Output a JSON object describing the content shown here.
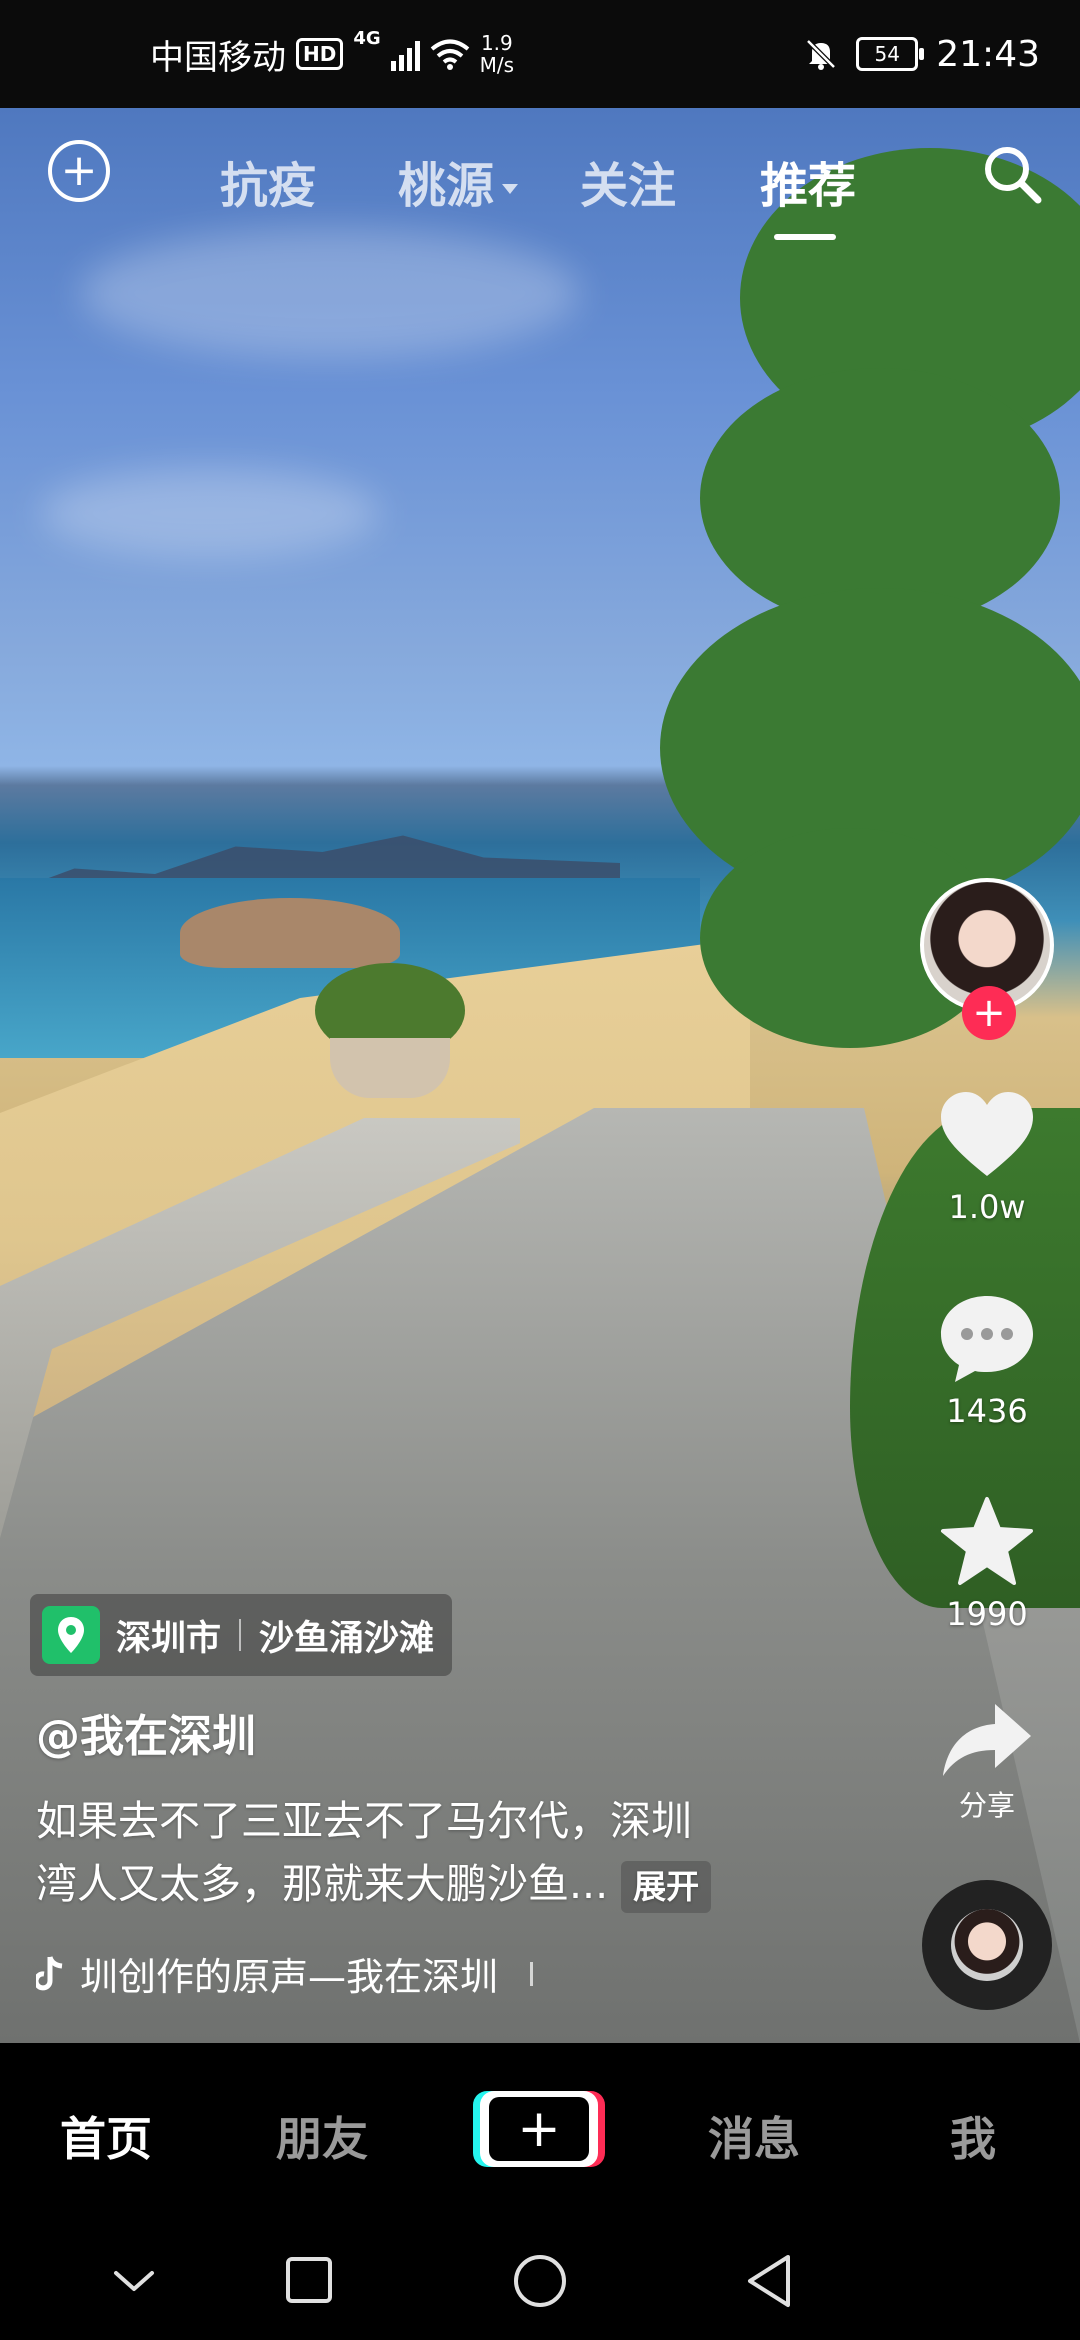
{
  "status_bar": {
    "carrier": "中国移动",
    "hd": "HD",
    "network": "4G",
    "speed_value": "1.9",
    "speed_unit": "M/s",
    "battery": "54",
    "time": "21:43"
  },
  "top_nav": {
    "tabs": [
      {
        "label": "抗疫"
      },
      {
        "label": "桃源"
      },
      {
        "label": "关注"
      },
      {
        "label": "推荐"
      }
    ],
    "active_tab": "推荐"
  },
  "side_actions": {
    "likes": "1.0w",
    "comments": "1436",
    "favorites": "1990",
    "share": "分享"
  },
  "location": {
    "city": "深圳市",
    "place": "沙鱼涌沙滩"
  },
  "post": {
    "author": "@我在深圳",
    "description_line1": "如果去不了三亚去不了马尔代，深圳",
    "description_line2": "湾人又太多，那就来大鹏沙鱼...",
    "expand": "展开",
    "music": "圳创作的原声—我在深圳"
  },
  "bottom_nav": {
    "items": [
      {
        "label": "首页"
      },
      {
        "label": "朋友"
      },
      {
        "label": "消息"
      },
      {
        "label": "我"
      }
    ]
  },
  "colors": {
    "accent": "#fe2c55",
    "cyan": "#25f4ee",
    "location_pin": "#20c06a"
  }
}
